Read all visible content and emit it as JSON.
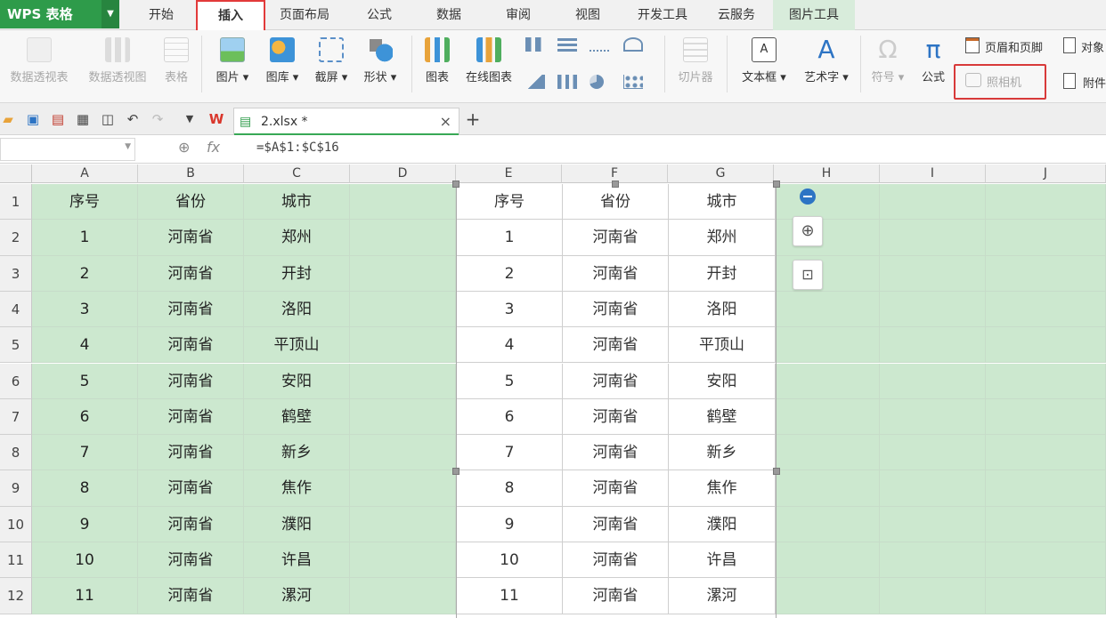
{
  "app": {
    "logo": "WPS 表格"
  },
  "menu": {
    "tabs": [
      "开始",
      "插入",
      "页面布局",
      "公式",
      "数据",
      "审阅",
      "视图",
      "开发工具",
      "云服务",
      "图片工具"
    ]
  },
  "ribbon": {
    "pivot_table": "数据透视表",
    "pivot_chart": "数据透视图",
    "table": "表格",
    "picture": "图片",
    "gallery": "图库",
    "screenshot": "截屏",
    "shapes": "形状",
    "chart": "图表",
    "online_chart": "在线图表",
    "slicer": "切片器",
    "textbox": "文本框",
    "wordart": "艺术字",
    "symbol": "符号",
    "formula": "公式",
    "header_footer": "页眉和页脚",
    "object": "对象",
    "camera": "照相机",
    "attachment": "附件"
  },
  "document": {
    "tab_name": "2.xlsx *"
  },
  "formula_bar": {
    "formula": "=$A$1:$C$16"
  },
  "columns": [
    "A",
    "B",
    "C",
    "D",
    "E",
    "F",
    "G",
    "H",
    "I",
    "J"
  ],
  "rows": [
    "1",
    "2",
    "3",
    "4",
    "5",
    "6",
    "7",
    "8",
    "9",
    "10",
    "11",
    "12"
  ],
  "sheet": {
    "header": [
      "序号",
      "省份",
      "城市"
    ],
    "data": [
      [
        "1",
        "河南省",
        "郑州"
      ],
      [
        "2",
        "河南省",
        "开封"
      ],
      [
        "3",
        "河南省",
        "洛阳"
      ],
      [
        "4",
        "河南省",
        "平顶山"
      ],
      [
        "5",
        "河南省",
        "安阳"
      ],
      [
        "6",
        "河南省",
        "鹤壁"
      ],
      [
        "7",
        "河南省",
        "新乡"
      ],
      [
        "8",
        "河南省",
        "焦作"
      ],
      [
        "9",
        "河南省",
        "濮阳"
      ],
      [
        "10",
        "河南省",
        "许昌"
      ],
      [
        "11",
        "河南省",
        "漯河"
      ]
    ]
  },
  "colors": {
    "accent": "#2e9b4a",
    "selection": "#cce8cf",
    "highlight_box": "#d83a3a"
  }
}
